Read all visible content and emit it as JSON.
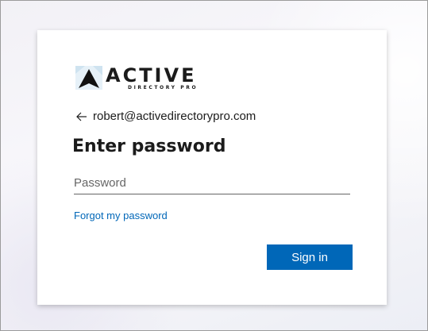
{
  "logo": {
    "main_text": "ACTIVE",
    "sub_text": "DIRECTORY PRO"
  },
  "identity": {
    "email": "robert@activedirectorypro.com",
    "back_icon": "back-arrow-icon"
  },
  "title": "Enter password",
  "password_field": {
    "placeholder": "Password",
    "value": ""
  },
  "forgot_link": "Forgot my password",
  "signin_button": "Sign in",
  "colors": {
    "accent": "#0067b8",
    "text": "#1b1b1b",
    "card_bg": "#ffffff"
  }
}
